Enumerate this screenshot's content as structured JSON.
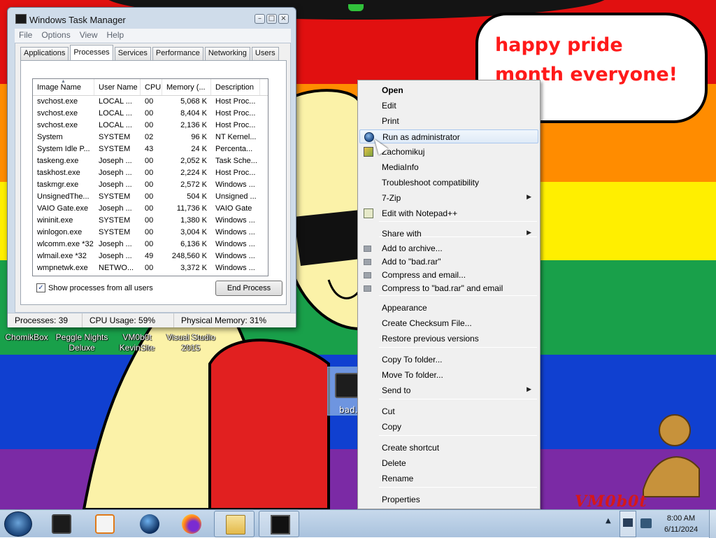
{
  "colors": {
    "stripes": [
      "#e11010",
      "#ff8c00",
      "#ffef00",
      "#19a04a",
      "#1040d0",
      "#7b2aa5"
    ],
    "speech_text": "#ff1a1a",
    "menu_hover": "#dfeaf7"
  },
  "wallpaper": {
    "speech": "happy pride month everyone!",
    "mascot_name": "VM0b0t"
  },
  "desktop_icons": [
    {
      "label": "ChomikBox"
    },
    {
      "label": "Peggle Nights Deluxe"
    },
    {
      "label": "VM0b0t KevinSite"
    },
    {
      "label": "Visual Studio 2015"
    }
  ],
  "dragged_file": {
    "label": "bad."
  },
  "task_manager": {
    "title": "Windows Task Manager",
    "menu": [
      "File",
      "Options",
      "View",
      "Help"
    ],
    "tabs": [
      "Applications",
      "Processes",
      "Services",
      "Performance",
      "Networking",
      "Users"
    ],
    "active_tab": "Processes",
    "columns": [
      "Image Name",
      "User Name",
      "CPU",
      "Memory (...",
      "Description"
    ],
    "rows": [
      [
        "svchost.exe",
        "LOCAL ...",
        "00",
        "5,068 K",
        "Host Proc..."
      ],
      [
        "svchost.exe",
        "LOCAL ...",
        "00",
        "8,404 K",
        "Host Proc..."
      ],
      [
        "svchost.exe",
        "LOCAL ...",
        "00",
        "2,136 K",
        "Host Proc..."
      ],
      [
        "System",
        "SYSTEM",
        "02",
        "96 K",
        "NT Kernel..."
      ],
      [
        "System Idle P...",
        "SYSTEM",
        "43",
        "24 K",
        "Percenta..."
      ],
      [
        "taskeng.exe",
        "Joseph ...",
        "00",
        "2,052 K",
        "Task Sche..."
      ],
      [
        "taskhost.exe",
        "Joseph ...",
        "00",
        "2,224 K",
        "Host Proc..."
      ],
      [
        "taskmgr.exe",
        "Joseph ...",
        "00",
        "2,572 K",
        "Windows ..."
      ],
      [
        "UnsignedThe...",
        "SYSTEM",
        "00",
        "504 K",
        "Unsigned ..."
      ],
      [
        "VAIO Gate.exe",
        "Joseph ...",
        "00",
        "11,736 K",
        "VAIO Gate"
      ],
      [
        "wininit.exe",
        "SYSTEM",
        "00",
        "1,380 K",
        "Windows ..."
      ],
      [
        "winlogon.exe",
        "SYSTEM",
        "00",
        "3,004 K",
        "Windows ..."
      ],
      [
        "wlcomm.exe *32",
        "Joseph ...",
        "00",
        "6,136 K",
        "Windows ..."
      ],
      [
        "wlmail.exe *32",
        "Joseph ...",
        "49",
        "248,560 K",
        "Windows ..."
      ],
      [
        "wmpnetwk.exe",
        "NETWO...",
        "00",
        "3,372 K",
        "Windows ..."
      ]
    ],
    "show_all_label": "Show processes from all users",
    "show_all_checked": true,
    "end_process_label": "End Process",
    "status": {
      "processes": "Processes: 39",
      "cpu": "CPU Usage: 59%",
      "memory": "Physical Memory: 31%"
    }
  },
  "context_menu": {
    "items": [
      {
        "label": "Open",
        "bold": true
      },
      {
        "label": "Edit"
      },
      {
        "label": "Print"
      },
      {
        "label": "Run as administrator",
        "icon": "admin-shield-icon",
        "hover": true
      },
      {
        "label": "Zachomikuj",
        "icon": "chomikuj-icon"
      },
      {
        "label": "MediaInfo"
      },
      {
        "label": "Troubleshoot compatibility"
      },
      {
        "label": "7-Zip",
        "submenu": true
      },
      {
        "label": "Edit with Notepad++",
        "icon": "notepad-plus-plus-icon"
      },
      {
        "label": "Share with",
        "submenu": true
      },
      {
        "label": "Add to archive...",
        "icon": "winrar-icon"
      },
      {
        "label": "Add to \"bad.rar\"",
        "icon": "winrar-icon"
      },
      {
        "label": "Compress and email...",
        "icon": "winrar-icon"
      },
      {
        "label": "Compress to \"bad.rar\" and email",
        "icon": "winrar-icon"
      },
      {
        "label": "Appearance"
      },
      {
        "label": "Create Checksum File..."
      },
      {
        "label": "Restore previous versions"
      },
      {
        "label": "Copy To folder..."
      },
      {
        "label": "Move To folder..."
      },
      {
        "label": "Send to",
        "submenu": true
      },
      {
        "label": "Cut"
      },
      {
        "label": "Copy"
      },
      {
        "label": "Create shortcut"
      },
      {
        "label": "Delete"
      },
      {
        "label": "Rename"
      },
      {
        "label": "Properties"
      }
    ]
  },
  "taskbar": {
    "pinned": [
      {
        "icon": "app-icon"
      },
      {
        "icon": "media-player-icon"
      },
      {
        "icon": "globe-icon"
      },
      {
        "icon": "firefox-icon"
      },
      {
        "icon": "explorer-icon",
        "active": true
      },
      {
        "icon": "task-manager-icon",
        "active": true
      }
    ],
    "clock": {
      "time": "8:00 AM",
      "date": "6/11/2024"
    }
  }
}
